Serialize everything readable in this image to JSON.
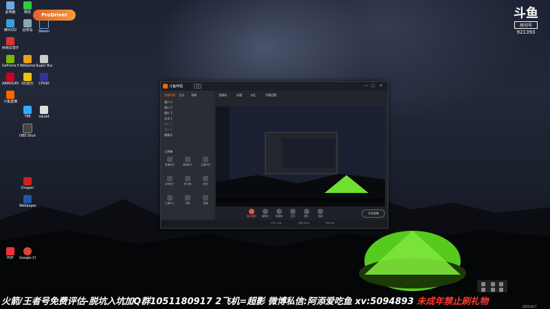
{
  "desktop": {
    "overlay_logo": "ProDriver",
    "icons": [
      {
        "label": "此电脑",
        "color": "#6fa8dc"
      },
      {
        "label": "微信",
        "color": "#2ecc40"
      },
      {
        "label": "腾讯QQ",
        "color": "#39a0e0"
      },
      {
        "label": "回收站",
        "color": "#8aa"
      },
      {
        "label": "Steam",
        "color": "#1b2838"
      },
      {
        "label": "网易云音乐",
        "color": "#d33"
      },
      {
        "label": "GeForce Experience",
        "color": "#76b900"
      },
      {
        "label": "WeGame",
        "color": "#e3a21a"
      },
      {
        "label": "Super Bunny Man",
        "color": "#ccc"
      },
      {
        "label": "ARMOURY CRATE",
        "color": "#c02"
      },
      {
        "label": "QQ音乐",
        "color": "#f4c20d"
      },
      {
        "label": "CPUID",
        "color": "#339"
      },
      {
        "label": "斗鱼直播",
        "color": "#f60"
      },
      {
        "label": "TIM",
        "color": "#3af"
      },
      {
        "label": "squad",
        "color": "#ddd"
      },
      {
        "label": "OBS Studio",
        "color": "#444"
      },
      {
        "label": "Dragon",
        "color": "#c22"
      },
      {
        "label": "Wallpaper Engine",
        "color": "#25a"
      },
      {
        "label": "Google Chrome",
        "color": "#db4437"
      },
      {
        "label": "PDF",
        "color": "#e33"
      }
    ]
  },
  "brand": {
    "mark": "斗鱼",
    "tag": "房间号",
    "room_number": "921393"
  },
  "app": {
    "title": "斗鱼伴侣",
    "version": "v5",
    "controls": [
      "—",
      "□",
      "×"
    ],
    "side_tabs": [
      "直播场景",
      "互动",
      "弹幕"
    ],
    "scenes": [
      "窗口 1",
      "窗口 2",
      "图片 1",
      "文本 1",
      "窗口 3",
      "窗口 4",
      "摄像头"
    ],
    "tools_title": "工具箱",
    "tools": [
      "直播助手",
      "弹幕助手",
      "主播任务",
      "游戏推广",
      "粉丝团",
      "更多",
      "主播中心",
      "排麦",
      "直播"
    ],
    "preview_top": [
      "直播间",
      "标题",
      "分区",
      "开播设置"
    ],
    "bottom_buttons": [
      {
        "label": "窗口捕获",
        "active": true
      },
      {
        "label": "摄像头",
        "active": false
      },
      {
        "label": "多媒体",
        "active": false
      },
      {
        "label": "文字",
        "active": false
      },
      {
        "label": "图片",
        "active": false
      },
      {
        "label": "音频",
        "active": false
      }
    ],
    "start_label": "开始直播",
    "status_items": [
      "CPU 12%",
      "内存 40%",
      "FPS 60"
    ]
  },
  "ticker": {
    "white_text": "火箭/王者号免费评估-脱坑入坑加Q群1051180917 2飞机=超影 微博私信:阿添爱吃鱼 xv:5094893 ",
    "red_text": "未成年禁止刷礼物"
  },
  "taskbar": {
    "clock": "2021/4/17"
  }
}
